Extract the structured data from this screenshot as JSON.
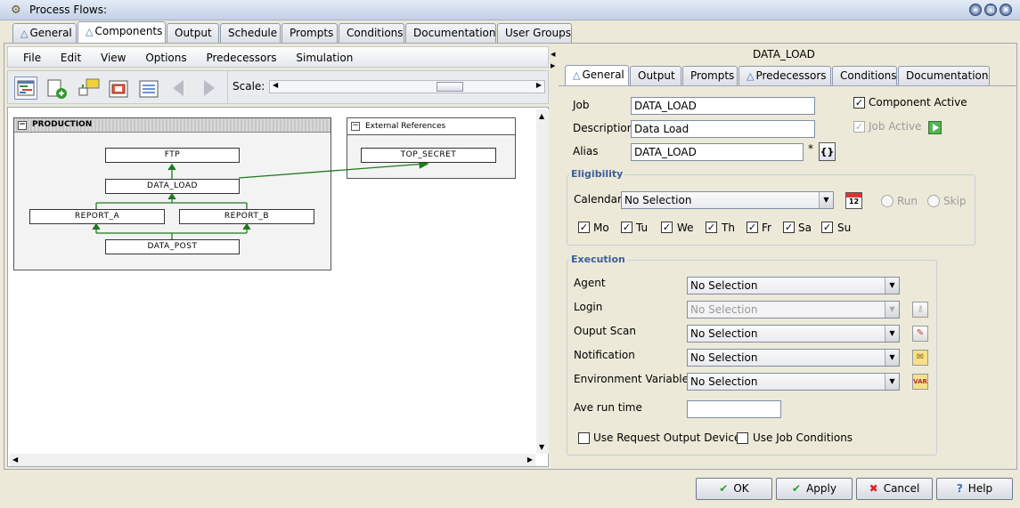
{
  "window": {
    "title": "Process Flows:"
  },
  "top_tabs": [
    "General",
    "Components",
    "Output",
    "Schedule",
    "Prompts",
    "Conditions",
    "Documentation",
    "User Groups"
  ],
  "menu": [
    "File",
    "Edit",
    "View",
    "Options",
    "Predecessors",
    "Simulation"
  ],
  "scale_label": "Scale:",
  "flow": {
    "group_name": "PRODUCTION",
    "nodes": [
      "FTP",
      "DATA_LOAD",
      "REPORT_A",
      "REPORT_B",
      "DATA_POST"
    ],
    "ext_title": "External References",
    "ext_node": "TOP_SECRET"
  },
  "right": {
    "header": "DATA_LOAD",
    "tabs": [
      "General",
      "Output",
      "Prompts",
      "Predecessors",
      "Conditions",
      "Documentation"
    ],
    "job_label": "Job",
    "job_value": "DATA_LOAD",
    "desc_label": "Description",
    "desc_value": "Data Load",
    "alias_label": "Alias",
    "alias_value": "DATA_LOAD",
    "alias_star": "*",
    "alias_btn": "{}",
    "component_active": "Component Active",
    "job_active": "Job Active",
    "eligibility": {
      "legend": "Eligibility",
      "calendar_label": "Calendar",
      "calendar_value": "No Selection",
      "calendar_icon_num": "12",
      "run": "Run",
      "skip": "Skip",
      "days": [
        "Mo",
        "Tu",
        "We",
        "Th",
        "Fr",
        "Sa",
        "Su"
      ]
    },
    "execution": {
      "legend": "Execution",
      "agent_label": "Agent",
      "agent_value": "No Selection",
      "login_label": "Login",
      "login_value": "No Selection",
      "scan_label": "Ouput Scan",
      "scan_value": "No Selection",
      "notif_label": "Notification",
      "notif_value": "No Selection",
      "env_label": "Environment Variables",
      "env_value": "No Selection",
      "env_icon": "VAR",
      "ave_label": "Ave run time",
      "ave_value": "",
      "use_request": "Use Request Output Device",
      "use_job_cond": "Use Job Conditions"
    }
  },
  "buttons": {
    "ok": "OK",
    "apply": "Apply",
    "cancel": "Cancel",
    "help": "Help"
  },
  "colors": {
    "accent": "#3a6fc0",
    "flow_line": "#1f7a1f",
    "legend": "#3d5f9a"
  }
}
